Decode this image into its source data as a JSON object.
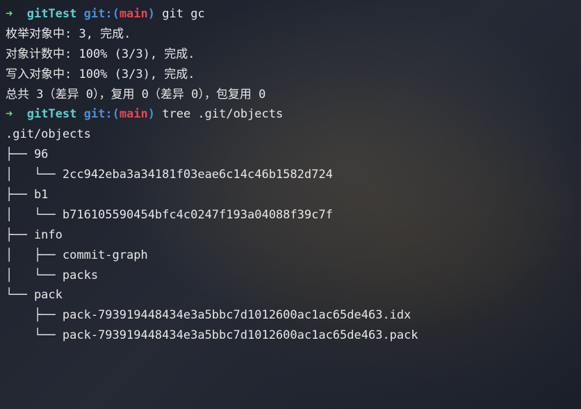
{
  "prompt1": {
    "arrow": "➜  ",
    "dir": "gitTest",
    "git_label": " git:",
    "paren_open": "(",
    "branch": "main",
    "paren_close": ")",
    "command": " git gc"
  },
  "output1": {
    "line1": "枚举对象中: 3, 完成.",
    "line2": "对象计数中: 100% (3/3), 完成.",
    "line3": "写入对象中: 100% (3/3), 完成.",
    "line4": "总共 3（差异 0），复用 0（差异 0），包复用 0"
  },
  "prompt2": {
    "arrow": "➜  ",
    "dir": "gitTest",
    "git_label": " git:",
    "paren_open": "(",
    "branch": "main",
    "paren_close": ")",
    "command": " tree .git/objects"
  },
  "tree": {
    "root": ".git/objects",
    "l1": "├── 96",
    "l2": "│   └── 2cc942eba3a34181f03eae6c14c46b1582d724",
    "l3": "├── b1",
    "l4": "│   └── b716105590454bfc4c0247f193a04088f39c7f",
    "l5": "├── info",
    "l6": "│   ├── commit-graph",
    "l7": "│   └── packs",
    "l8": "└── pack",
    "l9": "    ├── pack-793919448434e3a5bbc7d1012600ac1ac65de463.idx",
    "l10": "    └── pack-793919448434e3a5bbc7d1012600ac1ac65de463.pack"
  }
}
